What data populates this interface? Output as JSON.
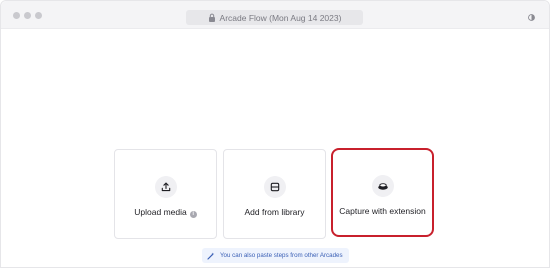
{
  "window": {
    "url_title": "Arcade Flow (Mon Aug 14 2023)"
  },
  "cards": [
    {
      "label": "Upload media",
      "icon": "upload-icon",
      "has_info": true
    },
    {
      "label": "Add from library",
      "icon": "library-icon",
      "has_info": false
    },
    {
      "label": "Capture with extension",
      "icon": "extension-icon",
      "has_info": false,
      "highlighted": true
    }
  ],
  "hint": {
    "text": "You can also paste steps from other Arcades",
    "icon": "magic-wand-icon"
  },
  "colors": {
    "highlight": "#c8202c",
    "hint_text": "#3a5fb5",
    "hint_bg": "#eef3fd"
  }
}
